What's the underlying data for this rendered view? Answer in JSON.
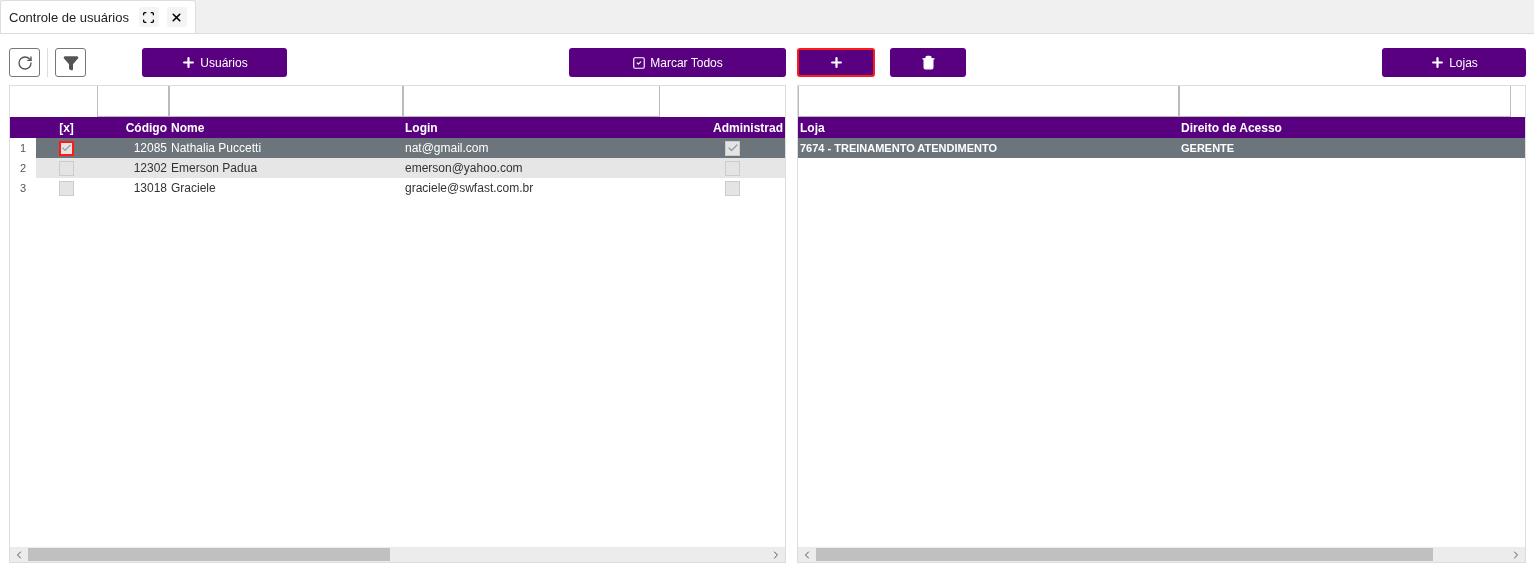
{
  "tab": {
    "title": "Controle de usuários"
  },
  "left_toolbar": [
    {
      "kind": "refresh",
      "focused": false
    },
    {
      "kind": "filter",
      "focused": false
    },
    {
      "kind": "add",
      "label": "Usuários",
      "focused": false
    },
    {
      "kind": "check_all",
      "label": "Marcar Todos",
      "focused": false
    }
  ],
  "users_table": {
    "columns": [
      "[x]",
      "Código",
      "Nome",
      "Login",
      "Administrad"
    ],
    "rows": [
      {
        "number": "1",
        "checked": true,
        "focused": true,
        "code": "12085",
        "name": "Nathalia Puccetti",
        "login": "nat@gmail.com",
        "admin": true,
        "selected": true
      },
      {
        "number": "2",
        "checked": false,
        "focused": false,
        "code": "12302",
        "name": "Emerson Padua",
        "login": "emerson@yahoo.com",
        "admin": false,
        "selected": false
      },
      {
        "number": "3",
        "checked": false,
        "focused": false,
        "code": "13018",
        "name": "Graciele",
        "login": "graciele@swfast.com.br",
        "admin": false,
        "selected": false
      }
    ]
  },
  "right_toolbar": [
    {
      "kind": "add",
      "focused": true
    },
    {
      "kind": "delete",
      "focused": false
    },
    {
      "kind": "add",
      "label": "Lojas",
      "focused": false
    }
  ],
  "stores_table": {
    "columns": [
      "Loja",
      "Direito de Acesso"
    ],
    "rows": [
      {
        "store": "7674 - TREINAMENTO ATENDIMENTO",
        "access": "GERENTE",
        "selected": true
      }
    ]
  }
}
